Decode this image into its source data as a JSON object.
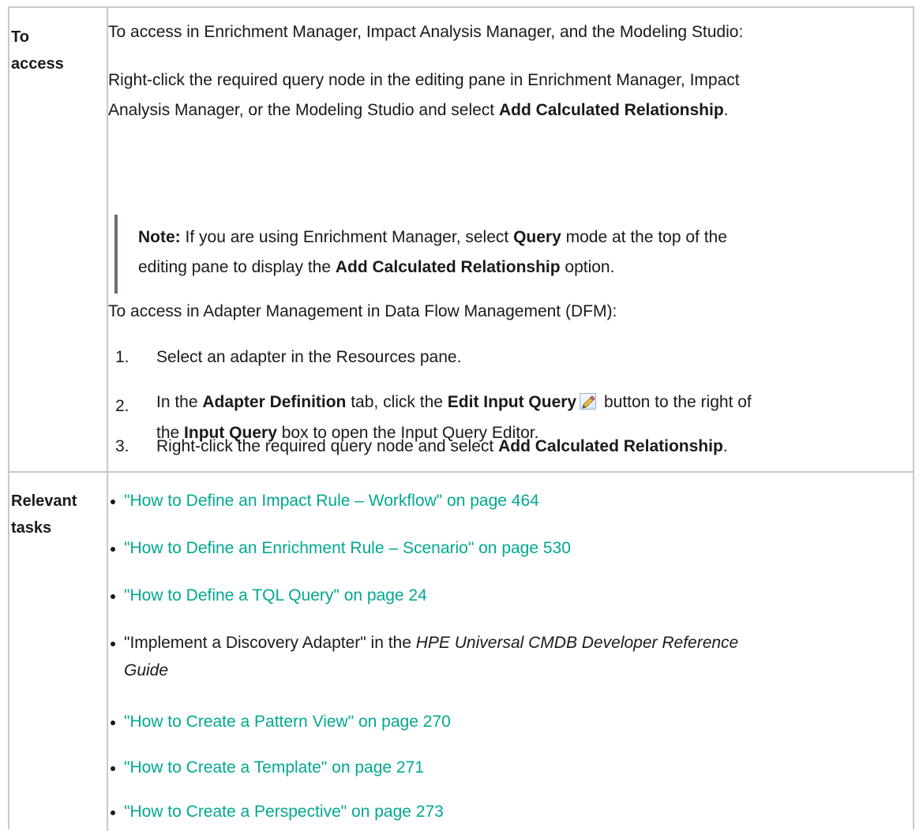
{
  "access": {
    "heading_line1": "To",
    "heading_line2": "access",
    "intro": "To access in Enrichment Manager, Impact Analysis Manager, and the Modeling Studio:",
    "rightclick_line1": "Right-click the required query node in the editing pane in Enrichment Manager, Impact",
    "rightclick_line2_pre": "Analysis Manager, or the Modeling Studio and select ",
    "rightclick_line2_bold": "Add Calculated Relationship",
    "rightclick_line2_post": ".",
    "note": {
      "label": "Note:",
      "line1_pre": "  If you are using Enrichment Manager, select ",
      "line1_bold": "Query",
      "line1_post": " mode at the top of the",
      "line2_pre": "editing pane to display the ",
      "line2_bold": "Add Calculated Relationship",
      "line2_post": " option."
    },
    "dfm_intro": "To access in Adapter Management in Data Flow Management (DFM):",
    "steps": [
      {
        "num": "1.",
        "text": "Select an adapter in the Resources pane."
      },
      {
        "num": "2.",
        "pre": "In the ",
        "bold1": "Adapter Definition",
        "mid1": " tab, click the ",
        "bold2": "Edit Input Query",
        "icon": "edit-pencil-icon",
        "post1": " button to the right of",
        "line2_pre": "the ",
        "line2_bold": "Input Query",
        "line2_post": " box to open the Input Query Editor."
      },
      {
        "num": "3.",
        "pre": "Right-click the required query node and select ",
        "bold": "Add Calculated Relationship",
        "post": "."
      }
    ]
  },
  "relevant": {
    "heading_line1": "Relevant",
    "heading_line2": "tasks",
    "items": [
      "\"How to Define an Impact Rule – Workflow\" on page 464",
      "\"How to Define an Enrichment Rule – Scenario\" on page 530",
      "\"How to Define a TQL Query\" on page 24",
      "\"Implement a Discovery Adapter\" in the ",
      "\"How to Create a Pattern View\" on page 270",
      "\"How to Create a Template\" on page 271",
      "\"How to Create a Perspective\" on page 273"
    ],
    "adapter_italic_line1": "HPE Universal CMDB Developer Reference",
    "adapter_italic_line2": "Guide"
  },
  "colors": {
    "link": "#00a890",
    "note_bar": "#76697a",
    "border": "#c8c8c8"
  }
}
